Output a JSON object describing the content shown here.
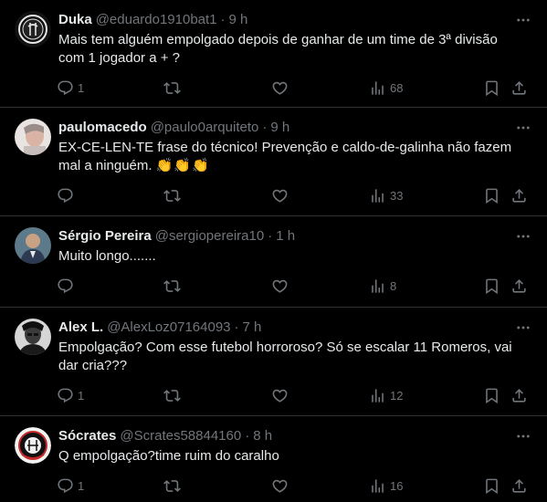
{
  "colors": {
    "background": "#000000",
    "text": "#e7e9ea",
    "secondary": "#71767b",
    "divider": "#2f3336"
  },
  "tweets": [
    {
      "name": "Duka",
      "handle": "@eduardo1910bat1",
      "separator": "·",
      "time": "9 h",
      "text": "Mais tem alguém empolgado depois de ganhar de um time de 3ª divisão com 1 jogador a + ?",
      "emoji": "",
      "replies": "1",
      "retweets": "",
      "likes": "",
      "views": "68",
      "avatar_icon": "corinthians-logo"
    },
    {
      "name": "paulomacedo",
      "handle": "@paulo0arquiteto",
      "separator": "·",
      "time": "9 h",
      "text": "EX-CE-LEN-TE frase do técnico! Prevenção e caldo-de-galinha não fazem mal a ninguém.",
      "emoji": "👏👏👏",
      "replies": "",
      "retweets": "",
      "likes": "",
      "views": "33",
      "avatar_icon": "user-photo"
    },
    {
      "name": "Sérgio Pereira",
      "handle": "@sergiopereira10",
      "separator": "·",
      "time": "1 h",
      "text": "Muito longo.......",
      "emoji": "",
      "replies": "",
      "retweets": "",
      "likes": "",
      "views": "8",
      "avatar_icon": "user-photo"
    },
    {
      "name": "Alex L.",
      "handle": "@AlexLoz07164093",
      "separator": "·",
      "time": "7 h",
      "text": "Empolgação? Com esse futebol horroroso? Só se escalar 11 Romeros, vai dar cria???",
      "emoji": "",
      "replies": "1",
      "retweets": "",
      "likes": "",
      "views": "12",
      "avatar_icon": "user-photo"
    },
    {
      "name": "Sócrates",
      "handle": "@Scrates58844160",
      "separator": "·",
      "time": "8 h",
      "text": "Q empolgação?time ruim do caralho",
      "emoji": "",
      "replies": "1",
      "retweets": "",
      "likes": "",
      "views": "16",
      "avatar_icon": "corinthians-logo"
    }
  ]
}
